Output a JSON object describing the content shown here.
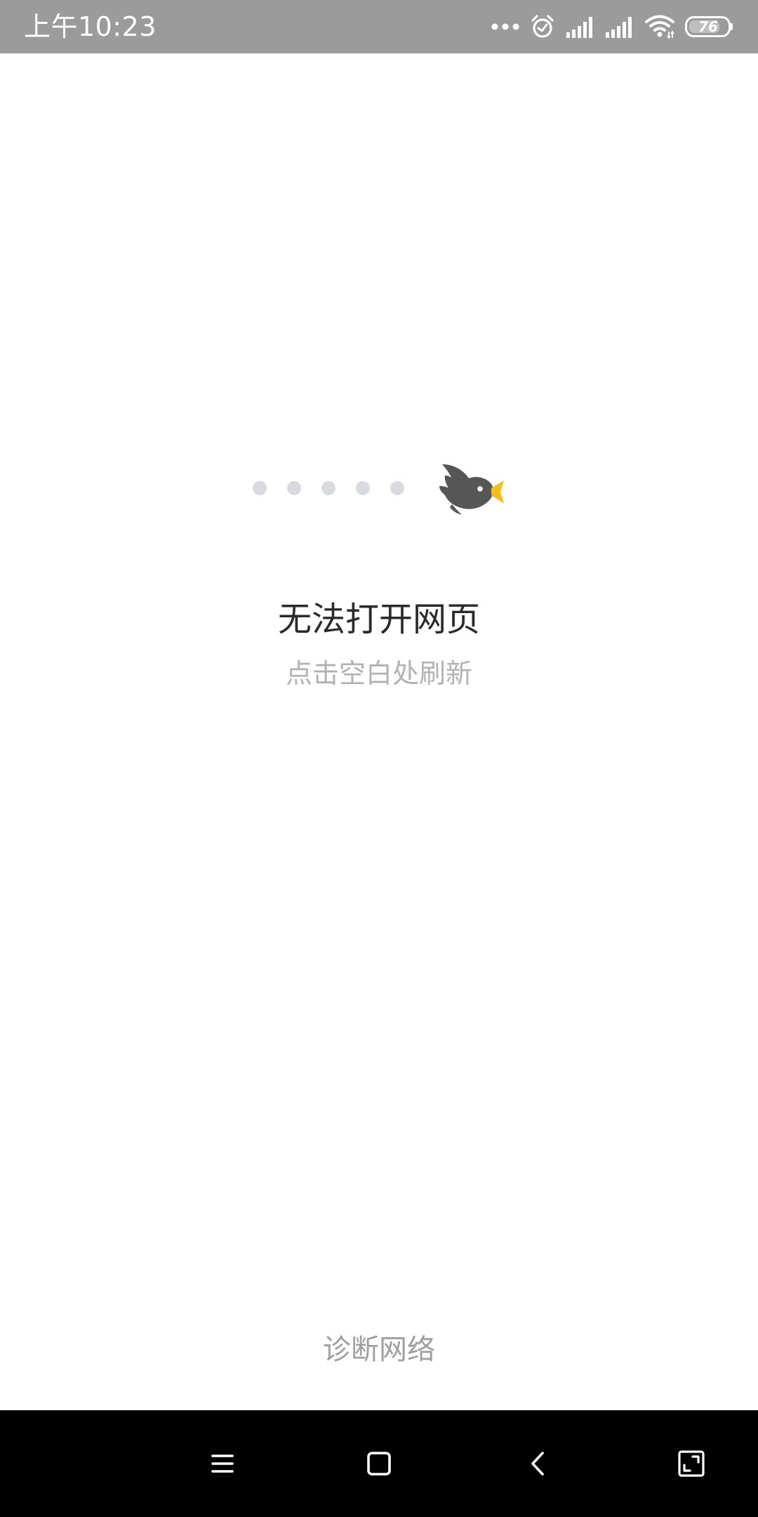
{
  "status_bar": {
    "time": "上午10:23",
    "battery_level": "76",
    "icons": [
      "more-dots-icon",
      "alarm-icon",
      "signal-icon",
      "signal-icon",
      "wifi-icon",
      "battery-icon"
    ]
  },
  "content": {
    "title": "无法打开网页",
    "subtitle": "点击空白处刷新",
    "diagnose_label": "诊断网络"
  },
  "illustration": {
    "dot_count": 5,
    "dot_color": "#d7dbe1",
    "bird_color": "#565656",
    "beak_color": "#f5bd17"
  },
  "nav_bar": {
    "buttons": [
      "menu-icon",
      "home-icon",
      "back-icon",
      "screen-expand-icon"
    ]
  },
  "colors": {
    "status_bar_bg": "#9b9b9b",
    "background": "#ffffff",
    "title_text": "#2a2a2a",
    "subtitle_text": "#b2b2b2",
    "nav_bar_bg": "#000000"
  }
}
